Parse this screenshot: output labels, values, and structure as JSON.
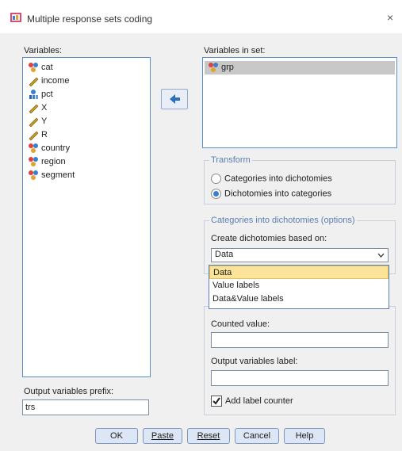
{
  "window": {
    "title": "Multiple response sets coding",
    "close_glyph": "×"
  },
  "variables": {
    "label": "Variables:",
    "items": [
      {
        "name": "cat",
        "icon": "nominal-icon"
      },
      {
        "name": "income",
        "icon": "scale-icon"
      },
      {
        "name": "pct",
        "icon": "ordinal-icon"
      },
      {
        "name": "X",
        "icon": "scale-icon"
      },
      {
        "name": "Y",
        "icon": "scale-icon"
      },
      {
        "name": "R",
        "icon": "scale-icon"
      },
      {
        "name": "country",
        "icon": "nominal-icon"
      },
      {
        "name": "region",
        "icon": "nominal-icon"
      },
      {
        "name": "segment",
        "icon": "nominal-icon"
      }
    ]
  },
  "set": {
    "label": "Variables in set:",
    "items": [
      {
        "name": "grp",
        "icon": "nominal-icon",
        "selected": true
      }
    ]
  },
  "transform": {
    "title": "Transform",
    "options": [
      {
        "label": "Categories into dichotomies",
        "checked": false
      },
      {
        "label": "Dichotomies into categories",
        "checked": true
      }
    ]
  },
  "options_group": {
    "title": "Categories into dichotomies (options)",
    "create_label": "Create dichotomies based on:",
    "selected": "Data",
    "dropdown_options": [
      "Data",
      "Value labels",
      "Data&Value labels"
    ],
    "highlighted_option": "Data"
  },
  "counted": {
    "label": "Counted value:",
    "value": ""
  },
  "output_label": {
    "label": "Output variables label:",
    "value": ""
  },
  "add_counter": {
    "label": "Add label counter",
    "checked": true
  },
  "prefix": {
    "label": "Output variables prefix:",
    "value": "trs"
  },
  "buttons": {
    "ok": "OK",
    "paste": "Paste",
    "reset": "Reset",
    "cancel": "Cancel",
    "help": "Help"
  },
  "colors": {
    "accent": "#3a7fd0",
    "panel": "#f0f0f0",
    "highlight": "#fbe49a",
    "group_title": "#5a7fb2"
  }
}
